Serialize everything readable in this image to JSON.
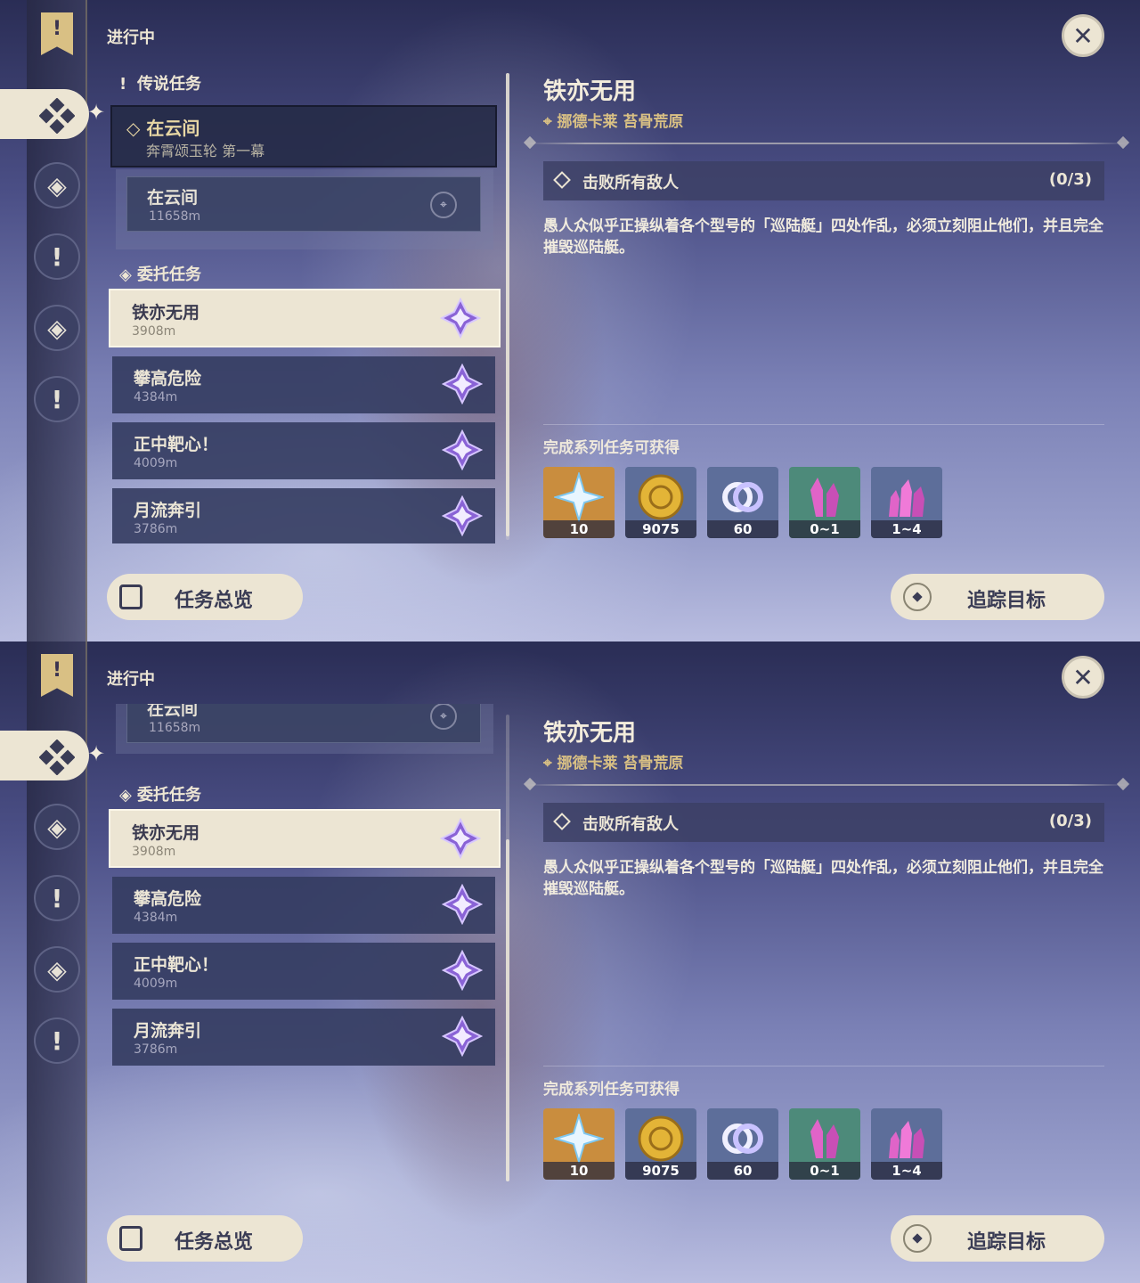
{
  "header": {
    "status_label": "进行中"
  },
  "rail": {
    "items": [
      {
        "name": "archon-quests",
        "glyph": "!"
      },
      {
        "name": "world-quests",
        "glyph": "◈"
      },
      {
        "name": "story-quests",
        "glyph": "!"
      },
      {
        "name": "commission-quests",
        "glyph": "◈"
      },
      {
        "name": "other-quests",
        "glyph": "!"
      }
    ]
  },
  "close_glyph": "✕",
  "list": {
    "archon_section": "传说任务",
    "archon": {
      "title": "在云间",
      "subtitle": "奔霄颂玉轮 第一幕"
    },
    "archon_sub": {
      "title": "在云间",
      "distance": "11658m"
    },
    "commission_section": "委托任务",
    "quests": [
      {
        "title": "铁亦无用",
        "distance": "3908m"
      },
      {
        "title": "攀高危险",
        "distance": "4384m"
      },
      {
        "title": "正中靶心！",
        "distance": "4009m"
      },
      {
        "title": "月流奔引",
        "distance": "3786m"
      }
    ]
  },
  "overview_button": "任务总览",
  "detail": {
    "title": "铁亦无用",
    "location": "挪德卡莱 苔骨荒原",
    "objective": "击败所有敌人",
    "progress": "(0/3)",
    "description": "愚人众似乎正操纵着各个型号的「巡陆艇」四处作乱，必须立刻阻止他们，并且完全摧毁巡陆艇。",
    "rewards_label": "完成系列任务可获得",
    "rewards": [
      {
        "name": "primogem",
        "count": "10",
        "bg": "#c98d3e"
      },
      {
        "name": "mora",
        "count": "9075",
        "bg": "#5d6e9a"
      },
      {
        "name": "adventure-exp",
        "count": "60",
        "bg": "#5d6e9a"
      },
      {
        "name": "crystal-chunk",
        "count": "0~1",
        "bg": "#4d8a7a"
      },
      {
        "name": "crystal-cluster",
        "count": "1~4",
        "bg": "#5d6e9a"
      }
    ]
  },
  "track_button": "追踪目标",
  "colors": {
    "accent": "#d9c084",
    "button_bg": "#ece5d3",
    "card_bg": "#343c60"
  }
}
